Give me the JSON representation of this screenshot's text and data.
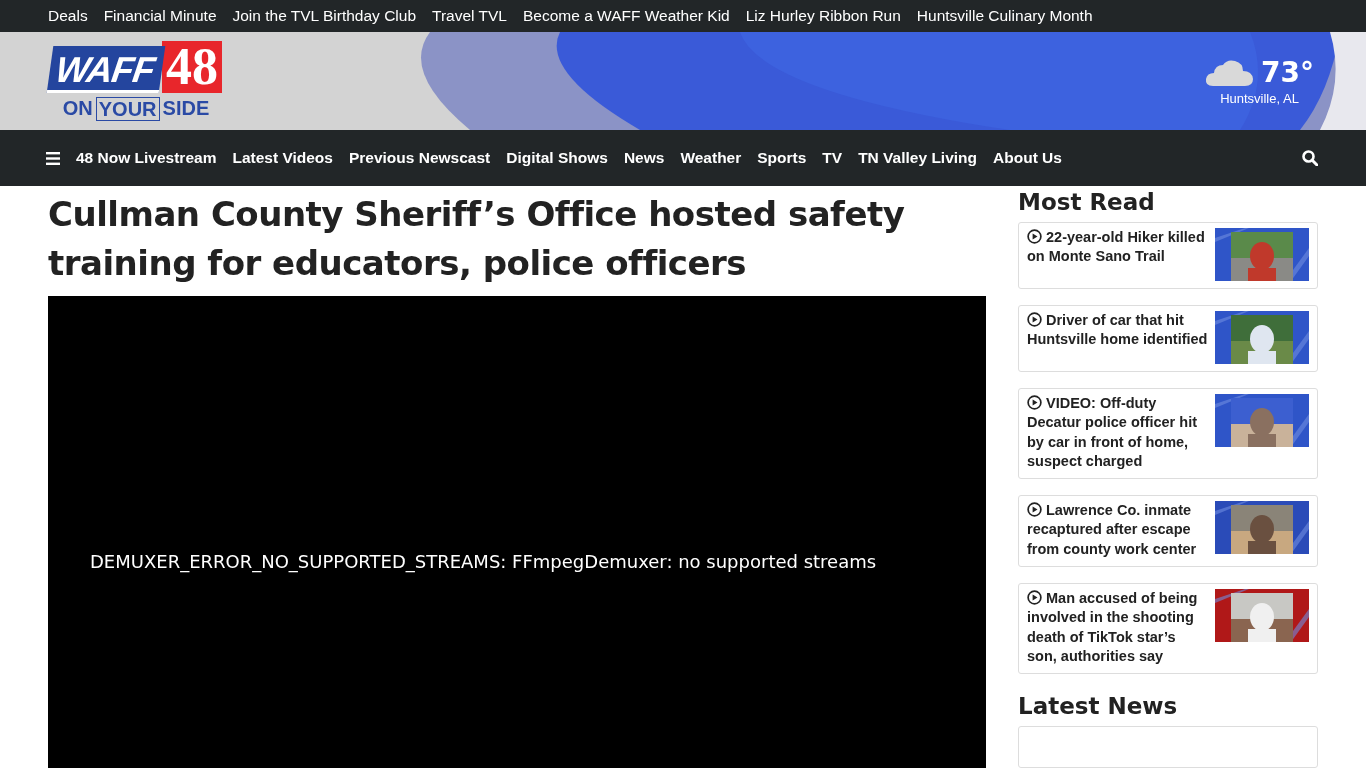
{
  "top_links": [
    "Deals",
    "Financial Minute",
    "Join the TVL Birthday Club",
    "Travel TVL",
    "Become a WAFF Weather Kid",
    "Liz Hurley Ribbon Run",
    "Huntsville Culinary Month"
  ],
  "logo": {
    "name": "WAFF",
    "number": "48",
    "tagline": [
      "ON",
      "YOUR",
      "SIDE"
    ]
  },
  "weather": {
    "temperature": "73°",
    "location": "Huntsville, AL"
  },
  "nav": [
    "48 Now Livestream",
    "Latest Videos",
    "Previous Newscast",
    "Digital Shows",
    "News",
    "Weather",
    "Sports",
    "TV",
    "TN Valley Living",
    "About Us"
  ],
  "article": {
    "title": "Cullman County Sheriff’s Office hosted safety training for educators, police officers",
    "video_error": "DEMUXER_ERROR_NO_SUPPORTED_STREAMS: FFmpegDemuxer: no supported streams"
  },
  "most_read": {
    "heading": "Most Read",
    "items": [
      {
        "title": "22-year-old Hiker killed on Monte Sano Trail",
        "kind": "picture"
      },
      {
        "title": "Driver of car that hit Huntsville home identified",
        "kind": "picture"
      },
      {
        "title": "VIDEO: Off-duty Decatur police officer hit by car in front of home, suspect charged",
        "kind": "picture"
      },
      {
        "title": "Lawrence Co. inmate recaptured after escape from county work center",
        "kind": "picture"
      },
      {
        "title": "Man accused of being involved in the shooting death of TikTok star’s son, authorities say",
        "kind": "picture"
      }
    ]
  },
  "latest_news": {
    "heading": "Latest News"
  }
}
